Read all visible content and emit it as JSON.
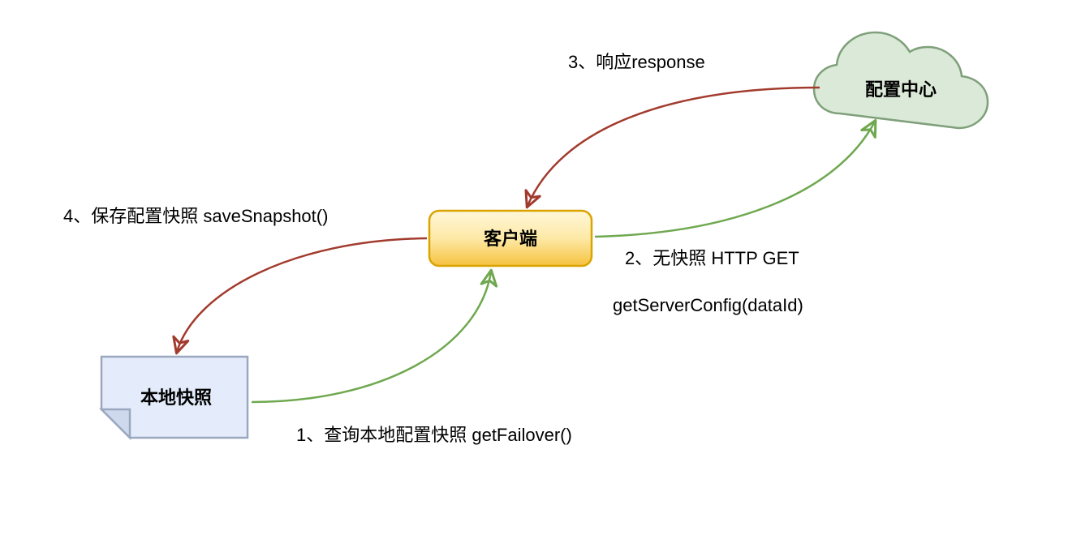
{
  "diagram": {
    "nodes": {
      "client": {
        "label": "客户端"
      },
      "config_center": {
        "label": "配置中心"
      },
      "local_snapshot": {
        "label": "本地快照"
      }
    },
    "edges": {
      "e1": {
        "label": "1、查询本地配置快照  getFailover()"
      },
      "e2_line1": {
        "label": "2、无快照 HTTP GET"
      },
      "e2_line2": {
        "label": "getServerConfig(dataId)"
      },
      "e3": {
        "label": "3、响应response"
      },
      "e4": {
        "label": "4、保存配置快照 saveSnapshot()"
      }
    },
    "colors": {
      "client_fill_top": "#fff2c9",
      "client_fill_bottom": "#f7c647",
      "client_stroke": "#d9a400",
      "cloud_fill": "#dbe9d8",
      "cloud_stroke": "#7fa07a",
      "note_fill": "#e4ecfb",
      "note_stroke": "#9aa7bf",
      "arrow_green": "#6fa84f",
      "arrow_red": "#a23b2e"
    }
  }
}
